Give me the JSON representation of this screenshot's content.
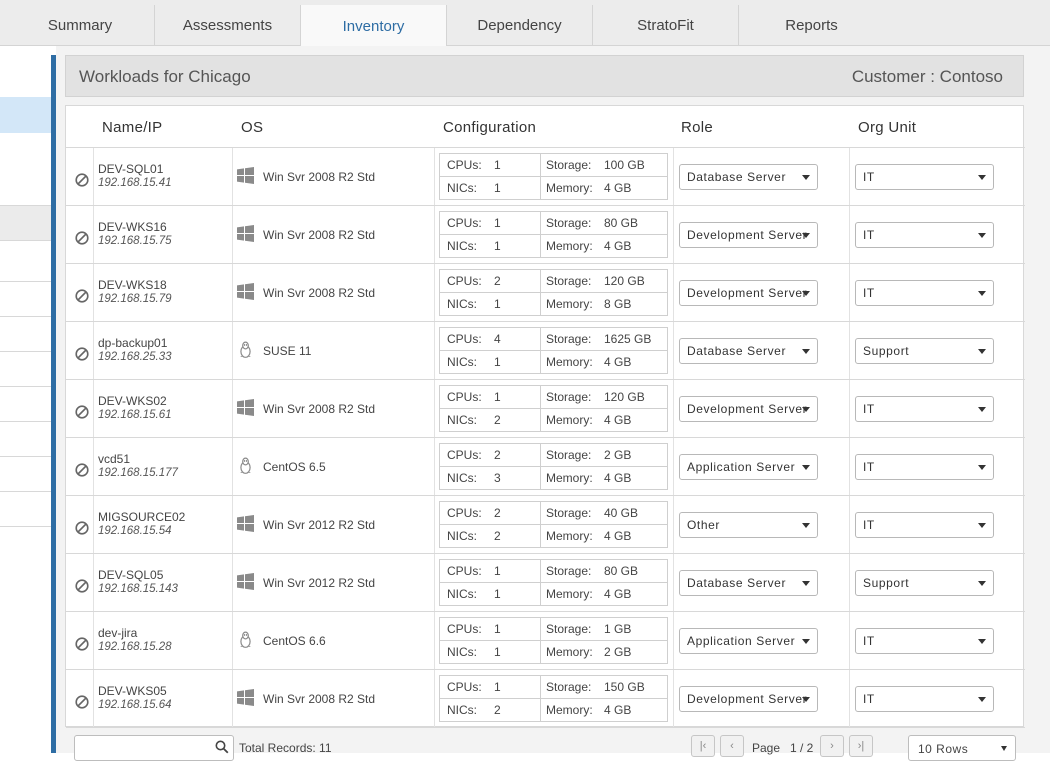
{
  "tabs": [
    {
      "label": "Summary",
      "active": false
    },
    {
      "label": "Assessments",
      "active": false
    },
    {
      "label": "Inventory",
      "active": true
    },
    {
      "label": "Dependency",
      "active": false
    },
    {
      "label": "StratoFit",
      "active": false
    },
    {
      "label": "Reports",
      "active": false
    }
  ],
  "header": {
    "title": "Workloads for Chicago",
    "customer": "Customer : Contoso"
  },
  "columns": {
    "name": "Name/IP",
    "os": "OS",
    "config": "Configuration",
    "role": "Role",
    "org": "Org Unit"
  },
  "config_labels": {
    "cpus": "CPUs:",
    "storage": "Storage:",
    "nics": "NICs:",
    "memory": "Memory:"
  },
  "rows": [
    {
      "name": "DEV-SQL01",
      "ip": "192.168.15.41",
      "os": "Win Svr 2008 R2 Std",
      "os_icon": "windows-icon",
      "cpus": "1",
      "storage": "100 GB",
      "nics": "1",
      "memory": "4 GB",
      "role": "Database Server",
      "org": "IT"
    },
    {
      "name": "DEV-WKS16",
      "ip": "192.168.15.75",
      "os": "Win Svr 2008 R2 Std",
      "os_icon": "windows-icon",
      "cpus": "1",
      "storage": "80 GB",
      "nics": "1",
      "memory": "4 GB",
      "role": "Development Server",
      "org": "IT"
    },
    {
      "name": "DEV-WKS18",
      "ip": "192.168.15.79",
      "os": "Win Svr 2008 R2 Std",
      "os_icon": "windows-icon",
      "cpus": "2",
      "storage": "120 GB",
      "nics": "1",
      "memory": "8 GB",
      "role": "Development Server",
      "org": "IT"
    },
    {
      "name": "dp-backup01",
      "ip": "192.168.25.33",
      "os": "SUSE 11",
      "os_icon": "linux-icon",
      "cpus": "4",
      "storage": "1625 GB",
      "nics": "1",
      "memory": "4 GB",
      "role": "Database Server",
      "org": "Support"
    },
    {
      "name": "DEV-WKS02",
      "ip": "192.168.15.61",
      "os": "Win Svr 2008 R2 Std",
      "os_icon": "windows-icon",
      "cpus": "1",
      "storage": "120 GB",
      "nics": "2",
      "memory": "4 GB",
      "role": "Development Server",
      "org": "IT"
    },
    {
      "name": "vcd51",
      "ip": "192.168.15.177",
      "os": "CentOS 6.5",
      "os_icon": "linux-icon",
      "cpus": "2",
      "storage": "2 GB",
      "nics": "3",
      "memory": "4 GB",
      "role": "Application Server",
      "org": "IT"
    },
    {
      "name": "MIGSOURCE02",
      "ip": "192.168.15.54",
      "os": "Win Svr 2012 R2 Std",
      "os_icon": "windows-icon",
      "cpus": "2",
      "storage": "40 GB",
      "nics": "2",
      "memory": "4 GB",
      "role": "Other",
      "org": "IT"
    },
    {
      "name": "DEV-SQL05",
      "ip": "192.168.15.143",
      "os": "Win Svr 2012 R2 Std",
      "os_icon": "windows-icon",
      "cpus": "1",
      "storage": "80 GB",
      "nics": "1",
      "memory": "4 GB",
      "role": "Database Server",
      "org": "Support"
    },
    {
      "name": "dev-jira",
      "ip": "192.168.15.28",
      "os": "CentOS 6.6",
      "os_icon": "linux-icon",
      "cpus": "1",
      "storage": "1 GB",
      "nics": "1",
      "memory": "2 GB",
      "role": "Application Server",
      "org": "IT"
    },
    {
      "name": "DEV-WKS05",
      "ip": "192.168.15.64",
      "os": "Win Svr 2008 R2 Std",
      "os_icon": "windows-icon",
      "cpus": "1",
      "storage": "150 GB",
      "nics": "2",
      "memory": "4 GB",
      "role": "Development Server",
      "org": "IT"
    }
  ],
  "footer": {
    "search_placeholder": "",
    "total_records": "Total Records: 11",
    "page_label": "Page",
    "page_value": "1 / 2",
    "rows_select": "10 Rows"
  },
  "colors": {
    "accent": "#2e6da4",
    "selected_row": "#d3e7f8"
  }
}
